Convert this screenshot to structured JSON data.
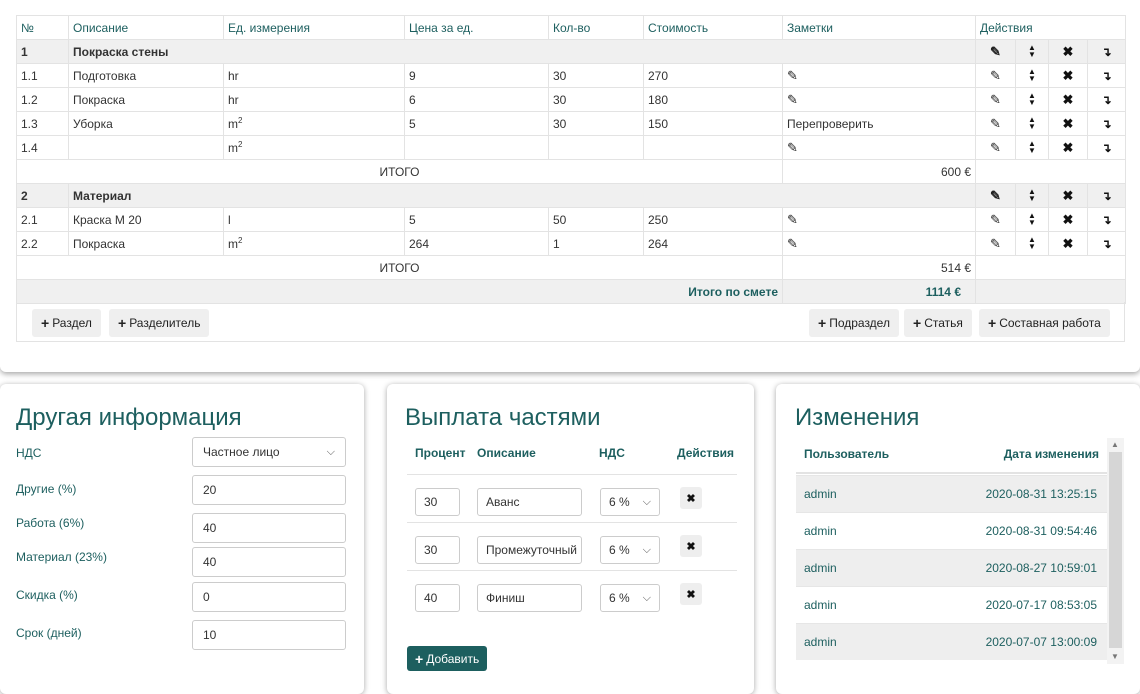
{
  "estimate": {
    "headers": {
      "num": "№",
      "desc": "Описание",
      "unit": "Ед. измерения",
      "price": "Цена за ед.",
      "qty": "Кол-во",
      "cost": "Стоимость",
      "notes": "Заметки",
      "actions": "Действия"
    },
    "sections": [
      {
        "num": "1",
        "title": "Покраска стены",
        "rows": [
          {
            "num": "1.1",
            "desc": "Подготовка",
            "unit": "hr",
            "unit_sup": "",
            "price": "9",
            "qty": "30",
            "cost": "270",
            "note": ""
          },
          {
            "num": "1.2",
            "desc": "Покраска",
            "unit": "hr",
            "unit_sup": "",
            "price": "6",
            "qty": "30",
            "cost": "180",
            "note": ""
          },
          {
            "num": "1.3",
            "desc": "Уборка",
            "unit": "m",
            "unit_sup": "2",
            "price": "5",
            "qty": "30",
            "cost": "150",
            "note": "Перепроверить"
          },
          {
            "num": "1.4",
            "desc": "",
            "unit": "m",
            "unit_sup": "2",
            "price": "",
            "qty": "",
            "cost": "",
            "note": ""
          }
        ],
        "total_label": "ИТОГО",
        "total": "600 €"
      },
      {
        "num": "2",
        "title": "Материал",
        "rows": [
          {
            "num": "2.1",
            "desc": "Краска М 20",
            "unit": "l",
            "unit_sup": "",
            "price": "5",
            "qty": "50",
            "cost": "250",
            "note": ""
          },
          {
            "num": "2.2",
            "desc": "Покраска",
            "unit": "m",
            "unit_sup": "2",
            "price": "264",
            "qty": "1",
            "cost": "264",
            "note": ""
          }
        ],
        "total_label": "ИТОГО",
        "total": "514 €"
      }
    ],
    "grand_label": "Итого по смете",
    "grand_total": "1114 €",
    "buttons": {
      "section": "Раздел",
      "divider": "Разделитель",
      "subsection": "Подраздел",
      "item": "Статья",
      "composite": "Составная работа"
    }
  },
  "other_info": {
    "title": "Другая информация",
    "fields": [
      {
        "label": "НДС",
        "value": "Частное лицо",
        "type": "select"
      },
      {
        "label": "Другие (%)",
        "value": "20",
        "type": "input"
      },
      {
        "label": "Работа (6%)",
        "value": "40",
        "type": "input"
      },
      {
        "label": "Материал (23%)",
        "value": "40",
        "type": "input"
      },
      {
        "label": "Скидка (%)",
        "value": "0",
        "type": "input"
      },
      {
        "label": "Срок (дней)",
        "value": "10",
        "type": "input"
      }
    ]
  },
  "installments": {
    "title": "Выплата частями",
    "headers": {
      "percent": "Процент",
      "desc": "Описание",
      "vat": "НДС",
      "actions": "Действия"
    },
    "rows": [
      {
        "percent": "30",
        "desc": "Аванс",
        "vat": "6 %"
      },
      {
        "percent": "30",
        "desc": "Промежуточный",
        "vat": "6 %"
      },
      {
        "percent": "40",
        "desc": "Финиш",
        "vat": "6 %"
      }
    ],
    "add_label": "Добавить"
  },
  "changes": {
    "title": "Изменения",
    "headers": {
      "user": "Пользователь",
      "date": "Дата изменения"
    },
    "rows": [
      {
        "user": "admin",
        "date": "2020-08-31 13:25:15"
      },
      {
        "user": "admin",
        "date": "2020-08-31 09:54:46"
      },
      {
        "user": "admin",
        "date": "2020-08-27 10:59:01"
      },
      {
        "user": "admin",
        "date": "2020-07-17 08:53:05"
      },
      {
        "user": "admin",
        "date": "2020-07-07 13:00:09"
      }
    ]
  },
  "icons": {
    "edit": "pencil-icon",
    "move": "sort-icon",
    "delete": "close-icon",
    "insert": "enter-arrow-icon",
    "add": "plus-icon",
    "dropdown": "chevron-down-icon"
  },
  "colors": {
    "accent": "#1d5f5f",
    "section_bg": "#f0f0f0",
    "button_bg": "#efefef"
  }
}
